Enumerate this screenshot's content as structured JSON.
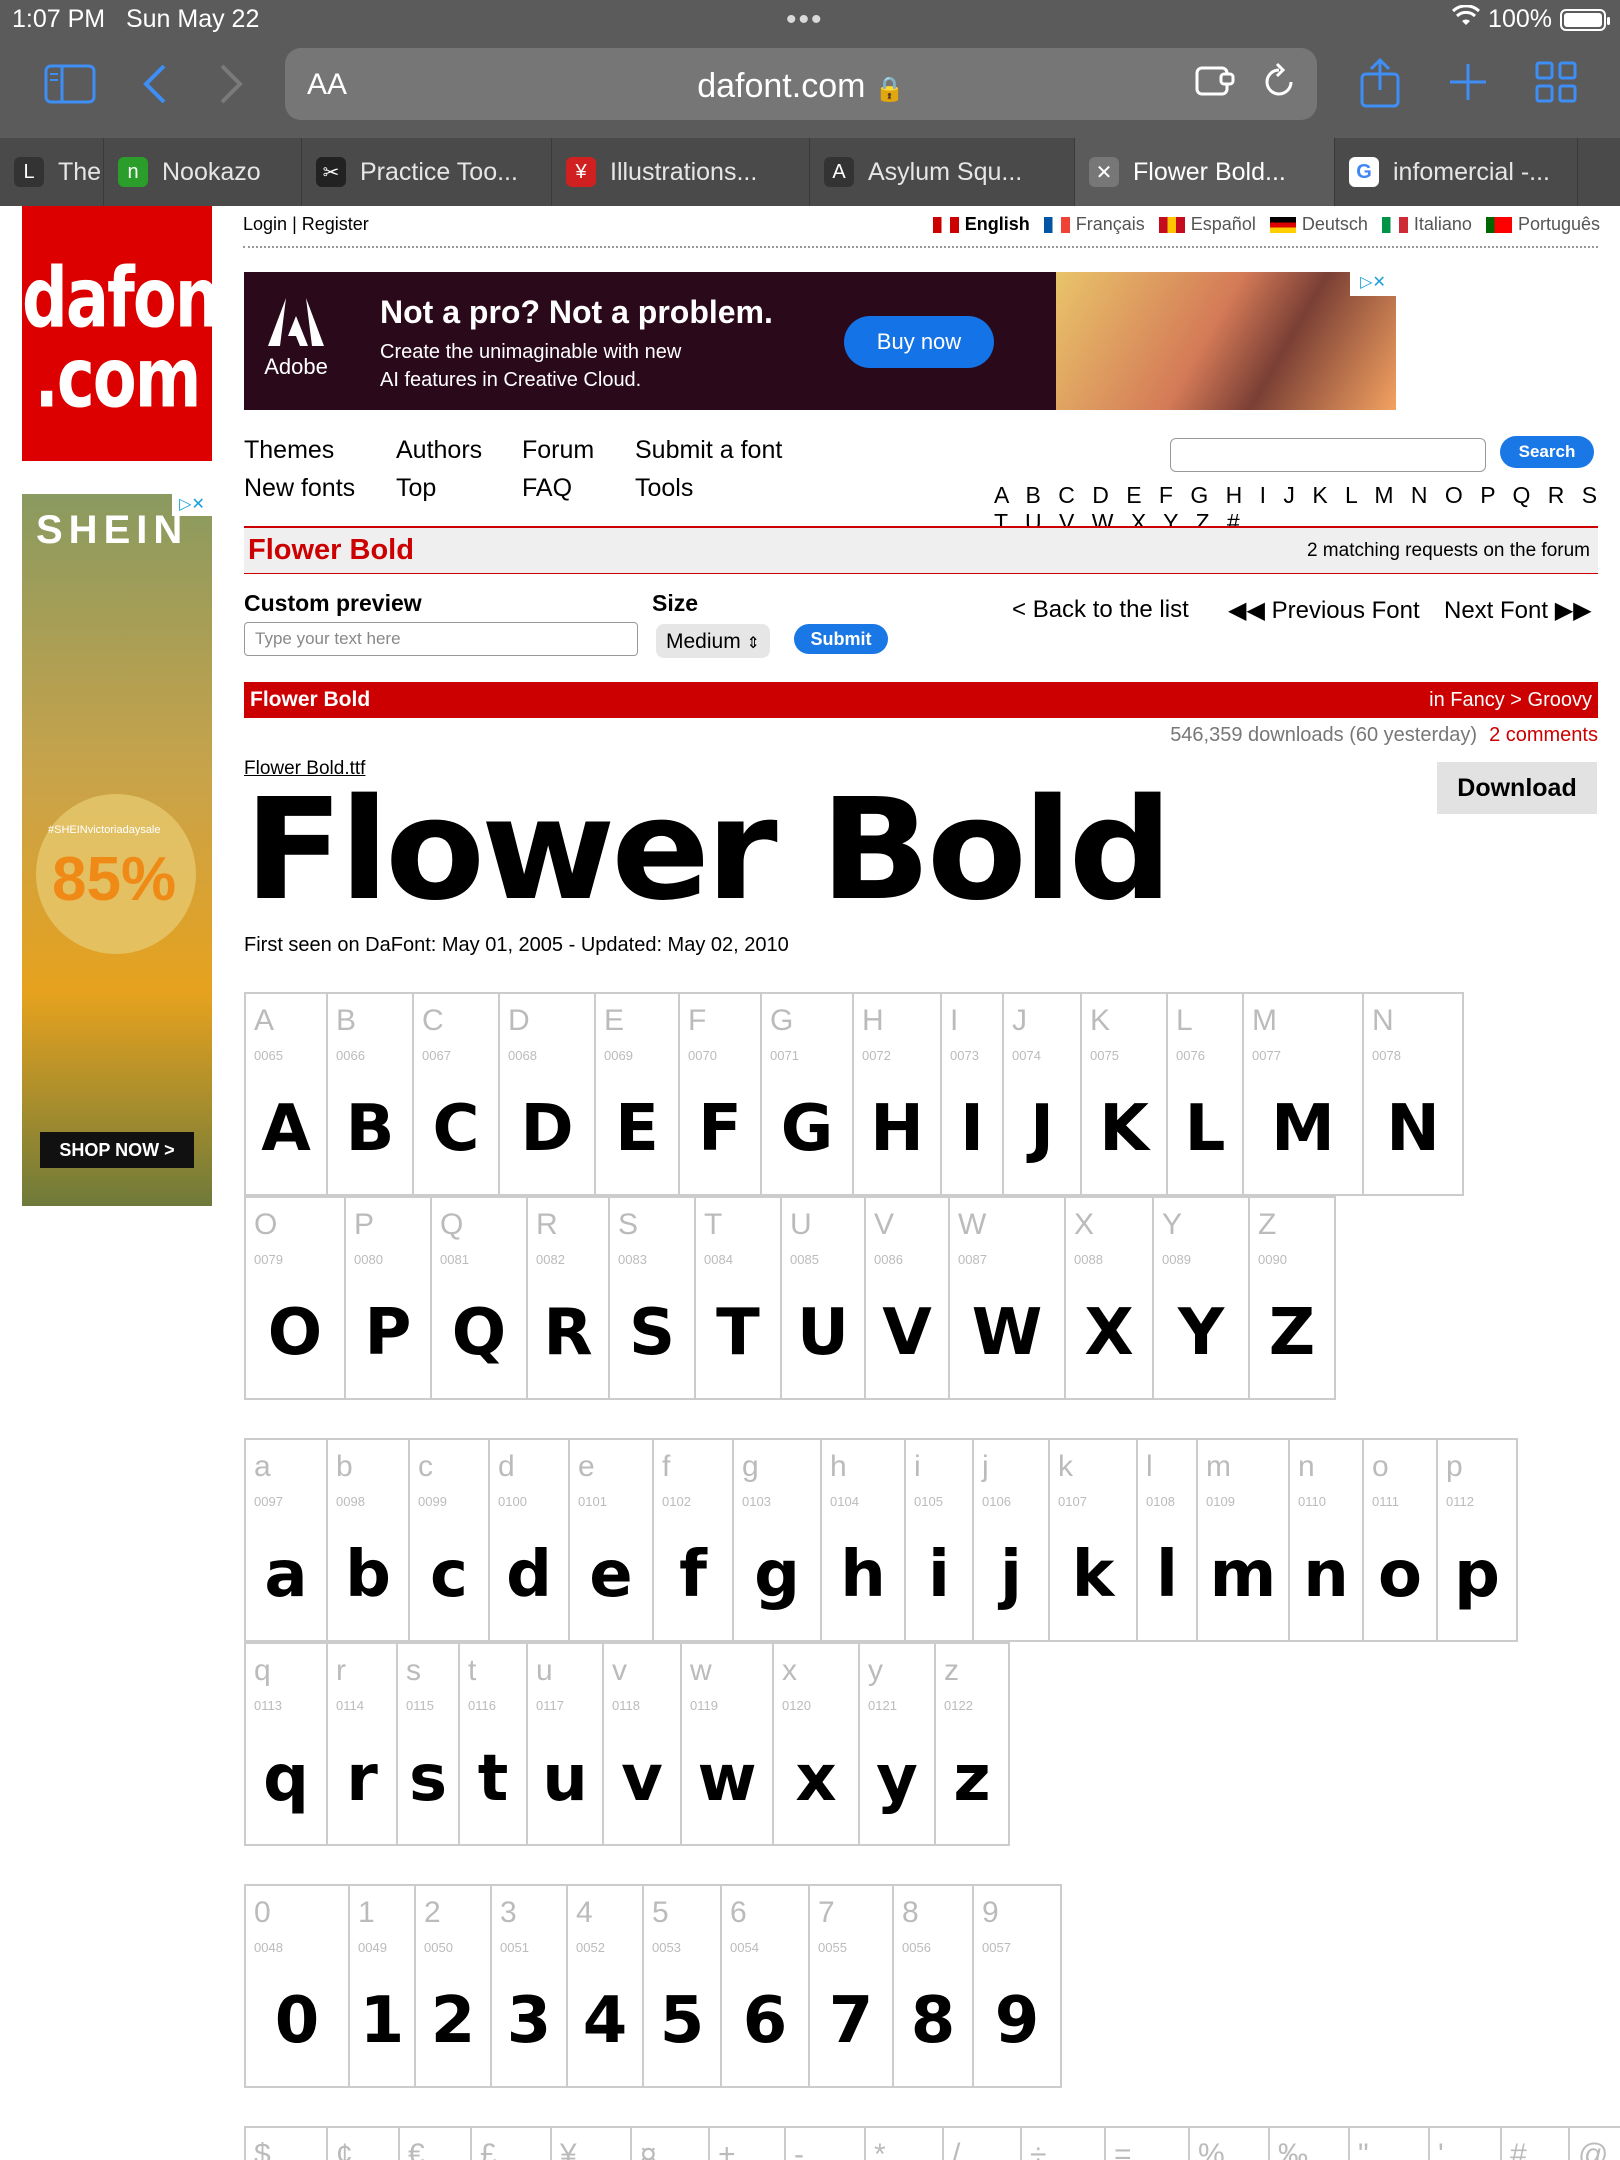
{
  "status": {
    "time": "1:07 PM",
    "date": "Sun May 22",
    "battery": "100%"
  },
  "browser": {
    "aa": "AA",
    "url": "dafont.com"
  },
  "tabs": [
    {
      "title": "The E",
      "fav": "L",
      "color": "#333"
    },
    {
      "title": "Nookazo",
      "fav": "n",
      "color": "#2a9d2a"
    },
    {
      "title": "Practice Too...",
      "fav": "✂",
      "color": "#222"
    },
    {
      "title": "Illustrations...",
      "fav": "¥",
      "color": "#d02020"
    },
    {
      "title": "Asylum Squ...",
      "fav": "A",
      "color": "#333"
    },
    {
      "title": "Flower Bold...",
      "fav": "✕",
      "color": "#777"
    },
    {
      "title": "infomercial -...",
      "fav": "G",
      "color": "#fff"
    }
  ],
  "logo": {
    "line1": "dafont",
    "line2": ".com"
  },
  "sidead": {
    "brand": "SHEIN",
    "tag": "#SHEINvictoriadaysale",
    "pct": "85%",
    "shop": "SHOP NOW >"
  },
  "toplinks": {
    "login": "Login",
    "sep": "|",
    "register": "Register"
  },
  "langs": [
    "English",
    "Français",
    "Español",
    "Deutsch",
    "Italiano",
    "Português"
  ],
  "banner": {
    "brand": "Adobe",
    "headline": "Not a pro? Not a problem.",
    "sub1": "Create the unimaginable with new",
    "sub2": "AI features in Creative Cloud.",
    "cta": "Buy now"
  },
  "nav": {
    "themes": "Themes",
    "authors": "Authors",
    "forum": "Forum",
    "submit": "Submit a font",
    "newfonts": "New fonts",
    "top": "Top",
    "faq": "FAQ",
    "tools": "Tools",
    "search_btn": "Search"
  },
  "alphabet": "A B C D E F G H I J K L M N O P Q R S T U V W X Y Z #",
  "font": {
    "title": "Flower Bold",
    "forum": "2 matching requests on the forum",
    "custom_preview": "Custom preview",
    "placeholder": "Type your text here",
    "size_label": "Size",
    "size_value": "Medium",
    "submit": "Submit",
    "back": "Back to the list",
    "prev": "Previous Font",
    "next": "Next Font",
    "category": "in Fancy > Groovy",
    "downloads": "546,359 downloads (60 yesterday)",
    "comments": "2 comments",
    "download": "Download",
    "filename": "Flower Bold.ttf",
    "preview": "Flower Bold",
    "first_seen": "First seen on DaFont: May 01, 2005 - Updated: May 02, 2010"
  },
  "glyph_rows": [
    [
      [
        "A",
        "0065"
      ],
      [
        "B",
        "0066"
      ],
      [
        "C",
        "0067"
      ],
      [
        "D",
        "0068"
      ],
      [
        "E",
        "0069"
      ],
      [
        "F",
        "0070"
      ],
      [
        "G",
        "0071"
      ],
      [
        "H",
        "0072"
      ],
      [
        "I",
        "0073"
      ],
      [
        "J",
        "0074"
      ],
      [
        "K",
        "0075"
      ],
      [
        "L",
        "0076"
      ],
      [
        "M",
        "0077"
      ],
      [
        "N",
        "0078"
      ]
    ],
    [
      [
        "O",
        "0079"
      ],
      [
        "P",
        "0080"
      ],
      [
        "Q",
        "0081"
      ],
      [
        "R",
        "0082"
      ],
      [
        "S",
        "0083"
      ],
      [
        "T",
        "0084"
      ],
      [
        "U",
        "0085"
      ],
      [
        "V",
        "0086"
      ],
      [
        "W",
        "0087"
      ],
      [
        "X",
        "0088"
      ],
      [
        "Y",
        "0089"
      ],
      [
        "Z",
        "0090"
      ]
    ],
    [
      [
        "a",
        "0097"
      ],
      [
        "b",
        "0098"
      ],
      [
        "c",
        "0099"
      ],
      [
        "d",
        "0100"
      ],
      [
        "e",
        "0101"
      ],
      [
        "f",
        "0102"
      ],
      [
        "g",
        "0103"
      ],
      [
        "h",
        "0104"
      ],
      [
        "i",
        "0105"
      ],
      [
        "j",
        "0106"
      ],
      [
        "k",
        "0107"
      ],
      [
        "l",
        "0108"
      ],
      [
        "m",
        "0109"
      ],
      [
        "n",
        "0110"
      ],
      [
        "o",
        "0111"
      ],
      [
        "p",
        "0112"
      ]
    ],
    [
      [
        "q",
        "0113"
      ],
      [
        "r",
        "0114"
      ],
      [
        "s",
        "0115"
      ],
      [
        "t",
        "0116"
      ],
      [
        "u",
        "0117"
      ],
      [
        "v",
        "0118"
      ],
      [
        "w",
        "0119"
      ],
      [
        "x",
        "0120"
      ],
      [
        "y",
        "0121"
      ],
      [
        "z",
        "0122"
      ]
    ],
    [
      [
        "0",
        "0048"
      ],
      [
        "1",
        "0049"
      ],
      [
        "2",
        "0050"
      ],
      [
        "3",
        "0051"
      ],
      [
        "4",
        "0052"
      ],
      [
        "5",
        "0053"
      ],
      [
        "6",
        "0054"
      ],
      [
        "7",
        "0055"
      ],
      [
        "8",
        "0056"
      ],
      [
        "9",
        "0057"
      ]
    ],
    [
      [
        "$",
        ""
      ],
      [
        "¢",
        ""
      ],
      [
        "€",
        ""
      ],
      [
        "£",
        ""
      ],
      [
        "¥",
        ""
      ],
      [
        "¤",
        ""
      ],
      [
        "+",
        ""
      ],
      [
        "-",
        ""
      ],
      [
        "*",
        ""
      ],
      [
        "/",
        ""
      ],
      [
        "÷",
        ""
      ],
      [
        "=",
        ""
      ],
      [
        "%",
        ""
      ],
      [
        "‰",
        ""
      ],
      [
        "\"",
        ""
      ],
      [
        "'",
        ""
      ],
      [
        "#",
        ""
      ],
      [
        "@",
        ""
      ]
    ]
  ]
}
